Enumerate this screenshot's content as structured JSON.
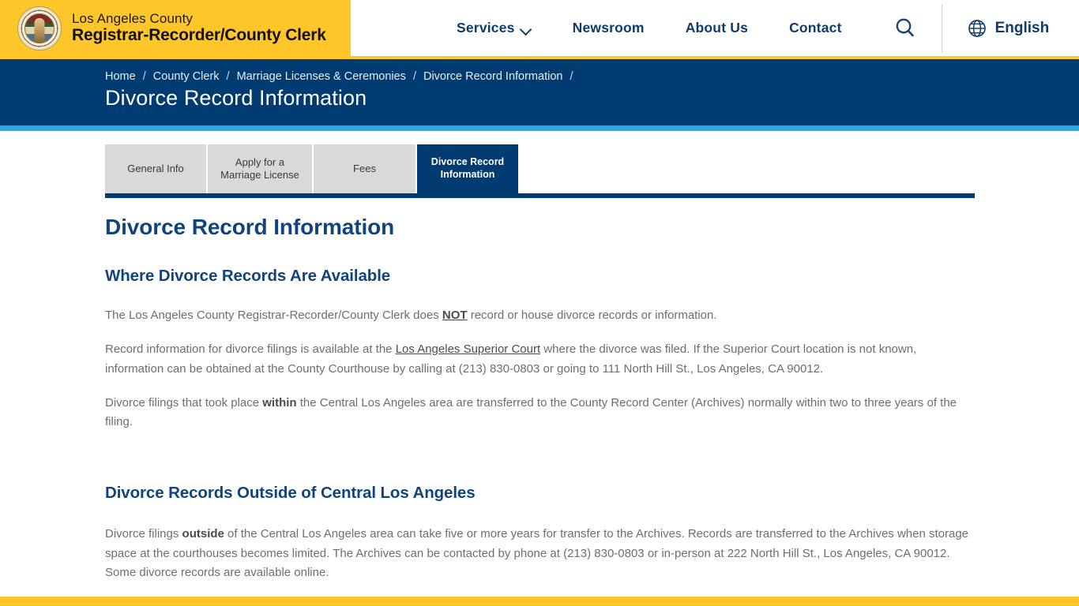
{
  "header": {
    "logo_icon": "la-county-seal",
    "brand_line1": "Los Angeles County",
    "brand_line2": "Registrar-Recorder/County Clerk",
    "nav": [
      {
        "label": "Services",
        "has_dropdown": true,
        "icon": "chevron-down-icon"
      },
      {
        "label": "Newsroom",
        "has_dropdown": false
      },
      {
        "label": "About Us",
        "has_dropdown": false
      },
      {
        "label": "Contact",
        "has_dropdown": false
      }
    ],
    "search_icon": "search-icon",
    "language_icon": "globe-icon",
    "language_label": "English",
    "brand_bg_color": "#ffc629",
    "nav_text_color": "#103a6b"
  },
  "banner": {
    "breadcrumbs": [
      "Home",
      "County Clerk",
      "Marriage Licenses & Ceremonies",
      "Divorce Record Information"
    ],
    "separator": "/",
    "title": "Divorce Record Information",
    "bg_color": "#003b71",
    "accent_color": "#29abe2"
  },
  "tabs": [
    {
      "label": "General Info",
      "active": false
    },
    {
      "label": "Apply for a Marriage License",
      "active": false
    },
    {
      "label": "Fees",
      "active": false
    },
    {
      "label": "Divorce Record Information",
      "active": true
    }
  ],
  "main": {
    "page_title": "Divorce Record Information",
    "sections": [
      {
        "heading": "Where Divorce Records Are Available",
        "paragraphs": [
          {
            "parts": [
              {
                "text": "The Los Angeles County Registrar-Recorder/County Clerk does ",
                "style": "normal"
              },
              {
                "text": "NOT",
                "style": "bold-underline"
              },
              {
                "text": " record or house divorce records or information.",
                "style": "normal"
              }
            ]
          },
          {
            "parts": [
              {
                "text": "Record information for divorce filings is available at the ",
                "style": "normal"
              },
              {
                "text": "Los Angeles Superior Court",
                "style": "link"
              },
              {
                "text": " where the divorce was filed. If the Superior Court location is not known, information can be obtained at the County Courthouse by calling at (213) 830-0803 or going to 111 North Hill St., Los Angeles, CA 90012.",
                "style": "normal"
              }
            ]
          },
          {
            "parts": [
              {
                "text": "Divorce filings that took place ",
                "style": "normal"
              },
              {
                "text": "within",
                "style": "bold"
              },
              {
                "text": " the Central Los Angeles area are transferred to the County Record Center (Archives) normally within two to three years of the filing.",
                "style": "normal"
              }
            ]
          }
        ]
      },
      {
        "heading": "Divorce Records Outside of Central Los Angeles",
        "paragraphs": [
          {
            "parts": [
              {
                "text": "Divorce filings ",
                "style": "normal"
              },
              {
                "text": "outside",
                "style": "bold"
              },
              {
                "text": " of the Central Los Angeles area can take five or more years for transfer to the Archives. Records are transferred to the Archives when storage space at the courthouses becomes limited. The Archives can be contacted by phone at (213) 830-0803 or in-person at 222 North Hill St., Los Angeles, CA 90012. Some divorce records are available online.",
                "style": "normal"
              }
            ]
          }
        ]
      }
    ],
    "heading_color": "#11437e",
    "body_color": "#6e6e6e"
  },
  "footer": {
    "bar_color": "#ffc629"
  }
}
